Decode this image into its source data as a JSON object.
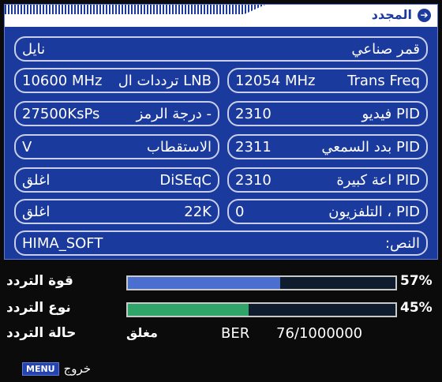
{
  "title": "المجدد",
  "fields": {
    "satellite": {
      "label": "قمر صناعي",
      "value": "نايل"
    },
    "lnb": {
      "label": "LNB ترددات ال",
      "value": "10600 MHz"
    },
    "trans": {
      "label": "Trans Freq",
      "value": "12054 MHz"
    },
    "symbol": {
      "label": "- درجة الرمز",
      "value": "27500KsPs"
    },
    "video_pid": {
      "label": "PID فيديو",
      "value": "2310"
    },
    "polarization": {
      "label": "الاستقطاب",
      "value": "V"
    },
    "audio_pid": {
      "label": "PID بدد السمعي",
      "value": "2311"
    },
    "diseqc": {
      "label": "DiSEqC",
      "value": "اغلق"
    },
    "pcr_pid": {
      "label": "PID اعة كبيرة",
      "value": "2310"
    },
    "k22": {
      "label": "22K",
      "value": "اغلق"
    },
    "tele_pid": {
      "label": "PID ، التلفزيون",
      "value": "0"
    },
    "text": {
      "label": "النص:",
      "value": "HIMA_SOFT"
    }
  },
  "signal": {
    "strength": {
      "label": "قوة التردد",
      "value": 57,
      "text": "57%",
      "color": "#4a6fcf"
    },
    "quality": {
      "label": "نوع التردد",
      "value": 45,
      "text": "45%",
      "color": "#2fa56a"
    },
    "status": {
      "label": "حالة التردد",
      "value": "مغلق",
      "ber_label": "BER",
      "ber_value": "76/1000000"
    }
  },
  "footer": {
    "menu": "MENU",
    "exit": "خروج"
  }
}
